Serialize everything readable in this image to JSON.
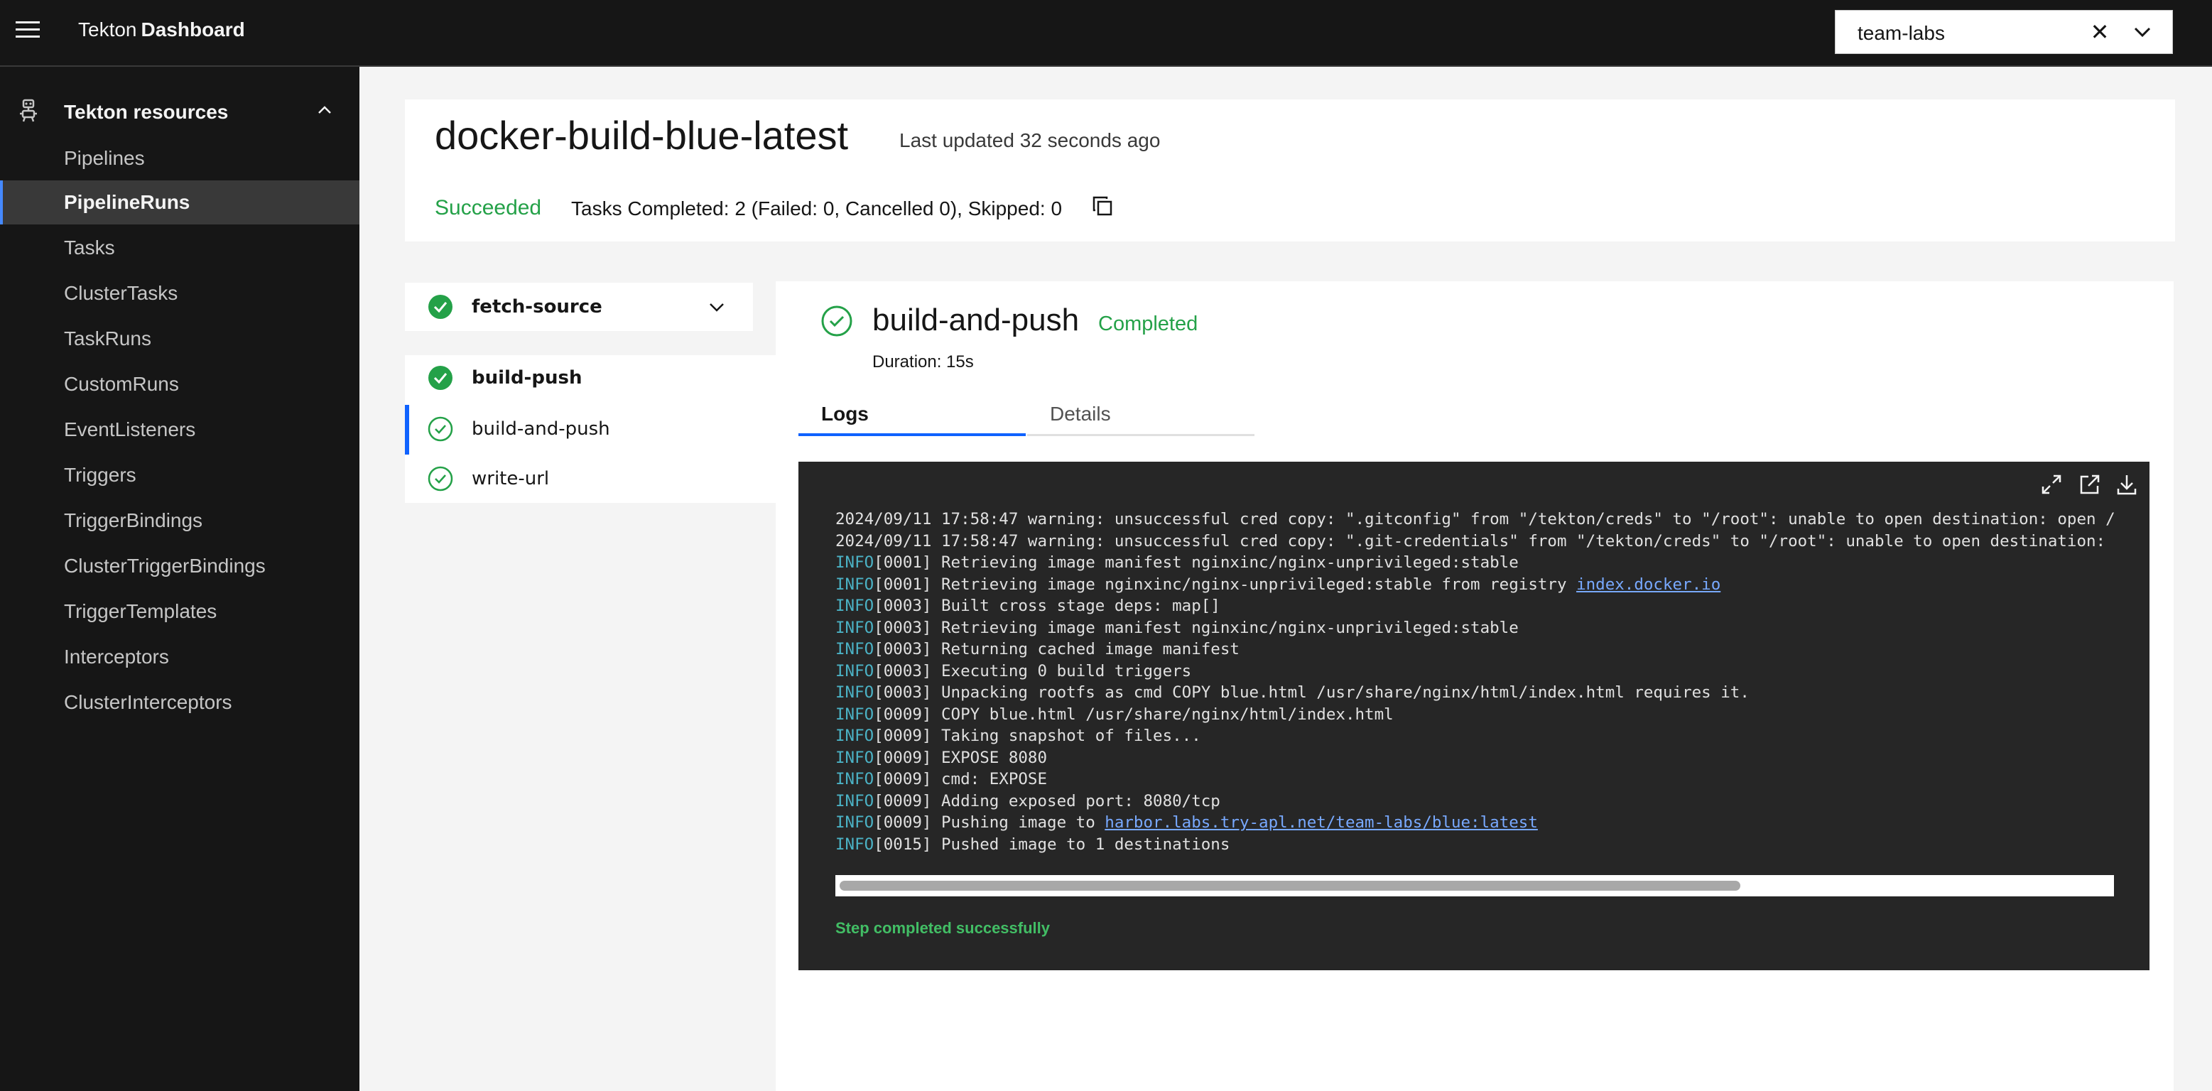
{
  "header": {
    "brand_light": "Tekton",
    "brand_bold": "Dashboard",
    "namespace_value": "team-labs",
    "clear_glyph": "✕"
  },
  "sidebar": {
    "section_label": "Tekton resources",
    "section_icon": "tekton-robot-icon",
    "items": [
      {
        "label": "Pipelines"
      },
      {
        "label": "PipelineRuns",
        "active": true
      },
      {
        "label": "Tasks"
      },
      {
        "label": "ClusterTasks"
      },
      {
        "label": "TaskRuns"
      },
      {
        "label": "CustomRuns"
      },
      {
        "label": "EventListeners"
      },
      {
        "label": "Triggers"
      },
      {
        "label": "TriggerBindings"
      },
      {
        "label": "ClusterTriggerBindings"
      },
      {
        "label": "TriggerTemplates"
      },
      {
        "label": "Interceptors"
      },
      {
        "label": "ClusterInterceptors"
      }
    ]
  },
  "run": {
    "title": "docker-build-blue-latest",
    "last_updated": "Last updated 32 seconds ago",
    "status": "Succeeded",
    "summary": "Tasks Completed: 2 (Failed: 0, Cancelled 0), Skipped: 0"
  },
  "tasks": [
    {
      "name": "fetch-source",
      "expanded": false
    },
    {
      "name": "build-push",
      "expanded": true,
      "steps": [
        {
          "name": "build-and-push",
          "selected": true
        },
        {
          "name": "write-url",
          "selected": false
        }
      ]
    }
  ],
  "step": {
    "title": "build-and-push",
    "status": "Completed",
    "duration": "Duration: 15s",
    "tabs": [
      "Logs",
      "Details"
    ],
    "active_tab": "Logs"
  },
  "log": {
    "lines": [
      {
        "prefix": "",
        "text": "2024/09/11 17:58:47 warning: unsuccessful cred copy: \".gitconfig\" from \"/tekton/creds\" to \"/root\": unable to open destination: open /",
        "link": ""
      },
      {
        "prefix": "",
        "text": "2024/09/11 17:58:47 warning: unsuccessful cred copy: \".git-credentials\" from \"/tekton/creds\" to \"/root\": unable to open destination:",
        "link": ""
      },
      {
        "prefix": "INFO",
        "text": "[0001] Retrieving image manifest nginxinc/nginx-unprivileged:stable",
        "link": ""
      },
      {
        "prefix": "INFO",
        "text": "[0001] Retrieving image nginxinc/nginx-unprivileged:stable from registry ",
        "link": "index.docker.io"
      },
      {
        "prefix": "INFO",
        "text": "[0003] Built cross stage deps: map[]",
        "link": ""
      },
      {
        "prefix": "INFO",
        "text": "[0003] Retrieving image manifest nginxinc/nginx-unprivileged:stable",
        "link": ""
      },
      {
        "prefix": "INFO",
        "text": "[0003] Returning cached image manifest",
        "link": ""
      },
      {
        "prefix": "INFO",
        "text": "[0003] Executing 0 build triggers",
        "link": ""
      },
      {
        "prefix": "INFO",
        "text": "[0003] Unpacking rootfs as cmd COPY blue.html /usr/share/nginx/html/index.html requires it.",
        "link": ""
      },
      {
        "prefix": "INFO",
        "text": "[0009] COPY blue.html /usr/share/nginx/html/index.html",
        "link": ""
      },
      {
        "prefix": "INFO",
        "text": "[0009] Taking snapshot of files...",
        "link": ""
      },
      {
        "prefix": "INFO",
        "text": "[0009] EXPOSE 8080",
        "link": ""
      },
      {
        "prefix": "INFO",
        "text": "[0009] cmd: EXPOSE",
        "link": ""
      },
      {
        "prefix": "INFO",
        "text": "[0009] Adding exposed port: 8080/tcp",
        "link": ""
      },
      {
        "prefix": "INFO",
        "text": "[0009] Pushing image to ",
        "link": "harbor.labs.try-apl.net/team-labs/blue:latest"
      },
      {
        "prefix": "INFO",
        "text": "[0015] Pushed image to 1 destinations",
        "link": ""
      }
    ],
    "footer": "Step completed successfully",
    "tools": [
      "maximize-icon",
      "open-in-new-window-icon",
      "download-icon"
    ]
  },
  "colors": {
    "success": "#24a148",
    "accent": "#0f62fe",
    "header_bg": "#161616",
    "log_bg": "#262626",
    "log_info": "#4bb2c5"
  }
}
